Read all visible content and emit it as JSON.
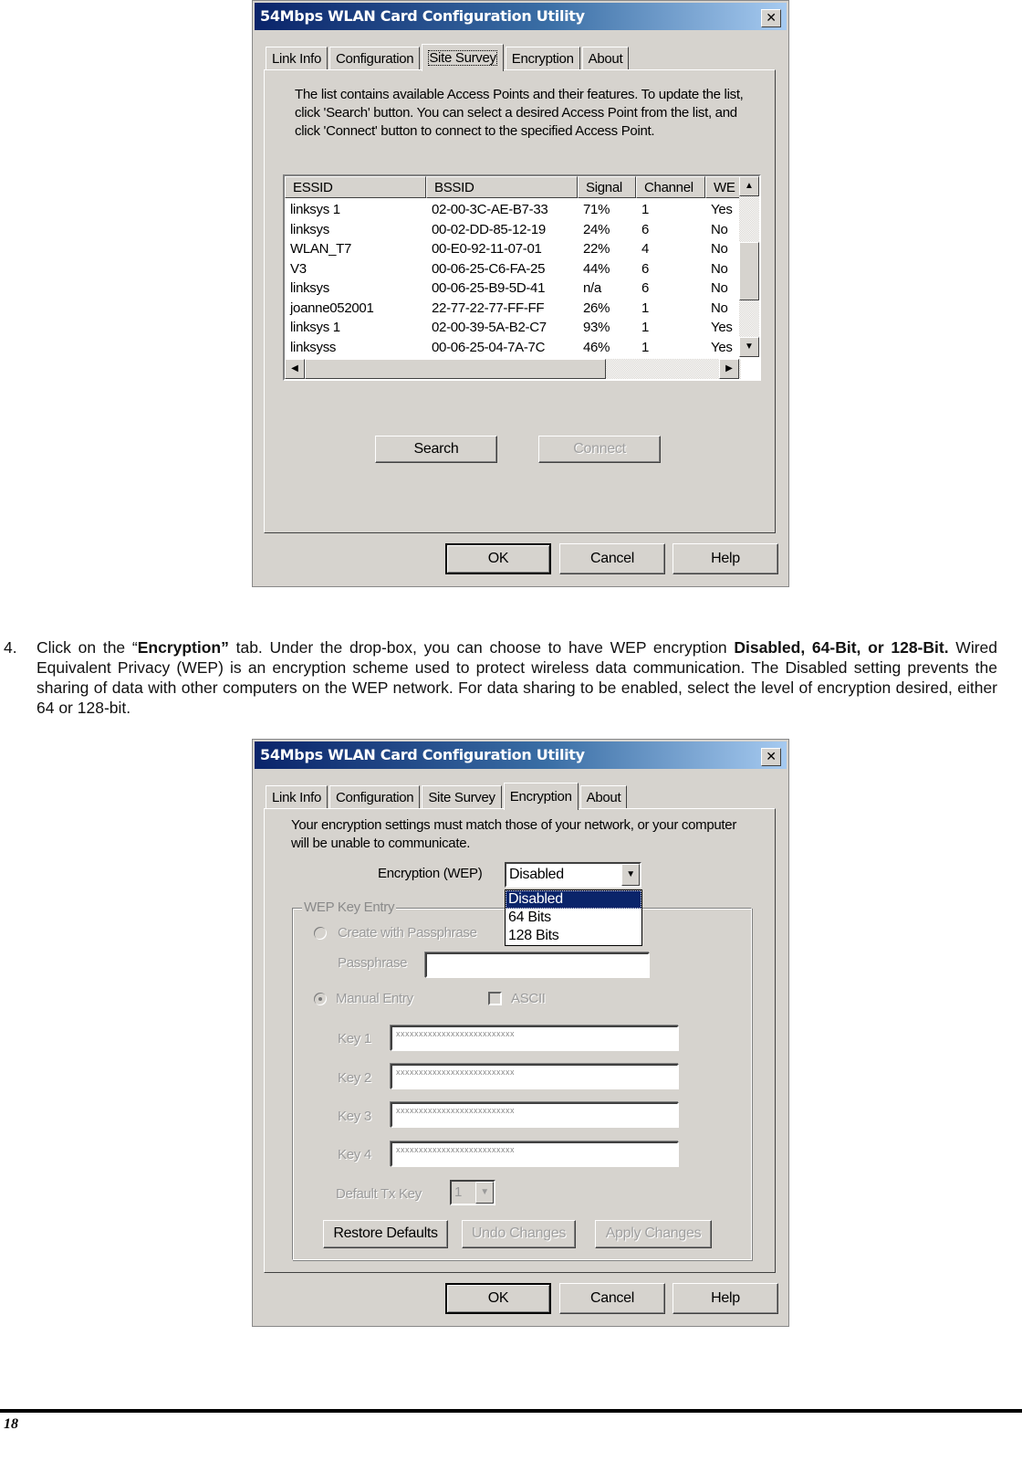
{
  "window": {
    "title": "54Mbps WLAN Card Configuration Utility",
    "close_icon": "close-x-icon"
  },
  "tabs": [
    "Link Info",
    "Configuration",
    "Site Survey",
    "Encryption",
    "About"
  ],
  "site_survey": {
    "active_tab": "Site Survey",
    "description": "The list contains available Access Points and their features. To update the list, click 'Search' button. You can select a desired Access Point from the list, and click 'Connect' button to connect to the specified Access Point.",
    "columns": [
      "ESSID",
      "BSSID",
      "Signal",
      "Channel",
      "WE"
    ],
    "rows": [
      {
        "essid": "linksys  1",
        "bssid": "02-00-3C-AE-B7-33",
        "signal": "71%",
        "channel": "1",
        "wep": "Yes"
      },
      {
        "essid": "linksys",
        "bssid": "00-02-DD-85-12-19",
        "signal": "24%",
        "channel": "6",
        "wep": "No"
      },
      {
        "essid": "WLAN_T7",
        "bssid": "00-E0-92-11-07-01",
        "signal": "22%",
        "channel": "4",
        "wep": "No"
      },
      {
        "essid": "V3",
        "bssid": "00-06-25-C6-FA-25",
        "signal": "44%",
        "channel": "6",
        "wep": "No"
      },
      {
        "essid": "linksys",
        "bssid": "00-06-25-B9-5D-41",
        "signal": "n/a",
        "channel": "6",
        "wep": "No"
      },
      {
        "essid": "joanne052001",
        "bssid": "22-77-22-77-FF-FF",
        "signal": "26%",
        "channel": "1",
        "wep": "No"
      },
      {
        "essid": "linksys  1",
        "bssid": "02-00-39-5A-B2-C7",
        "signal": "93%",
        "channel": "1",
        "wep": "Yes"
      },
      {
        "essid": "linksyss",
        "bssid": "00-06-25-04-7A-7C",
        "signal": "46%",
        "channel": "1",
        "wep": "Yes"
      }
    ],
    "search_button": "Search",
    "connect_button": "Connect"
  },
  "dialog_buttons": {
    "ok": "OK",
    "cancel": "Cancel",
    "help": "Help"
  },
  "instruction": {
    "number": "4.",
    "parts": [
      {
        "text": "Click on the “",
        "bold": false
      },
      {
        "text": "Encryption”",
        "bold": true
      },
      {
        "text": " tab. Under the drop-box, you can choose to have WEP encryption ",
        "bold": false
      },
      {
        "text": "Disabled, 64-Bit, or 128-Bit.",
        "bold": true
      },
      {
        "text": " Wired Equivalent Privacy (WEP) is an encryption scheme used to protect wireless data communication. The Disabled setting prevents the sharing of data with other computers on the WEP network. For data sharing to be enabled, select the level of encryption desired, either 64 or 128-bit.",
        "bold": false
      }
    ]
  },
  "encryption": {
    "active_tab": "Encryption",
    "description": "Your encryption settings must match those of your network, or your computer will be unable to communicate.",
    "encryption_label": "Encryption (WEP)",
    "encryption_value": "Disabled",
    "encryption_options": [
      "Disabled",
      "64 Bits",
      "128 Bits"
    ],
    "selected_option": "Disabled",
    "group_label": "WEP Key Entry",
    "create_passphrase_label": "Create with Passphrase",
    "passphrase_label": "Passphrase",
    "passphrase_value": "",
    "manual_entry_label": "Manual Entry",
    "manual_entry_selected": true,
    "ascii_label": "ASCII",
    "ascii_checked": false,
    "keys": [
      {
        "label": "Key 1",
        "value": "xxxxxxxxxxxxxxxxxxxxxxxxxx"
      },
      {
        "label": "Key 2",
        "value": "xxxxxxxxxxxxxxxxxxxxxxxxxx"
      },
      {
        "label": "Key 3",
        "value": "xxxxxxxxxxxxxxxxxxxxxxxxxx"
      },
      {
        "label": "Key 4",
        "value": "xxxxxxxxxxxxxxxxxxxxxxxxxx"
      }
    ],
    "default_tx_key_label": "Default Tx Key",
    "default_tx_key_value": "1",
    "restore_defaults": "Restore Defaults",
    "undo_changes": "Undo Changes",
    "apply_changes": "Apply Changes"
  },
  "footer": {
    "page_number": "18"
  }
}
